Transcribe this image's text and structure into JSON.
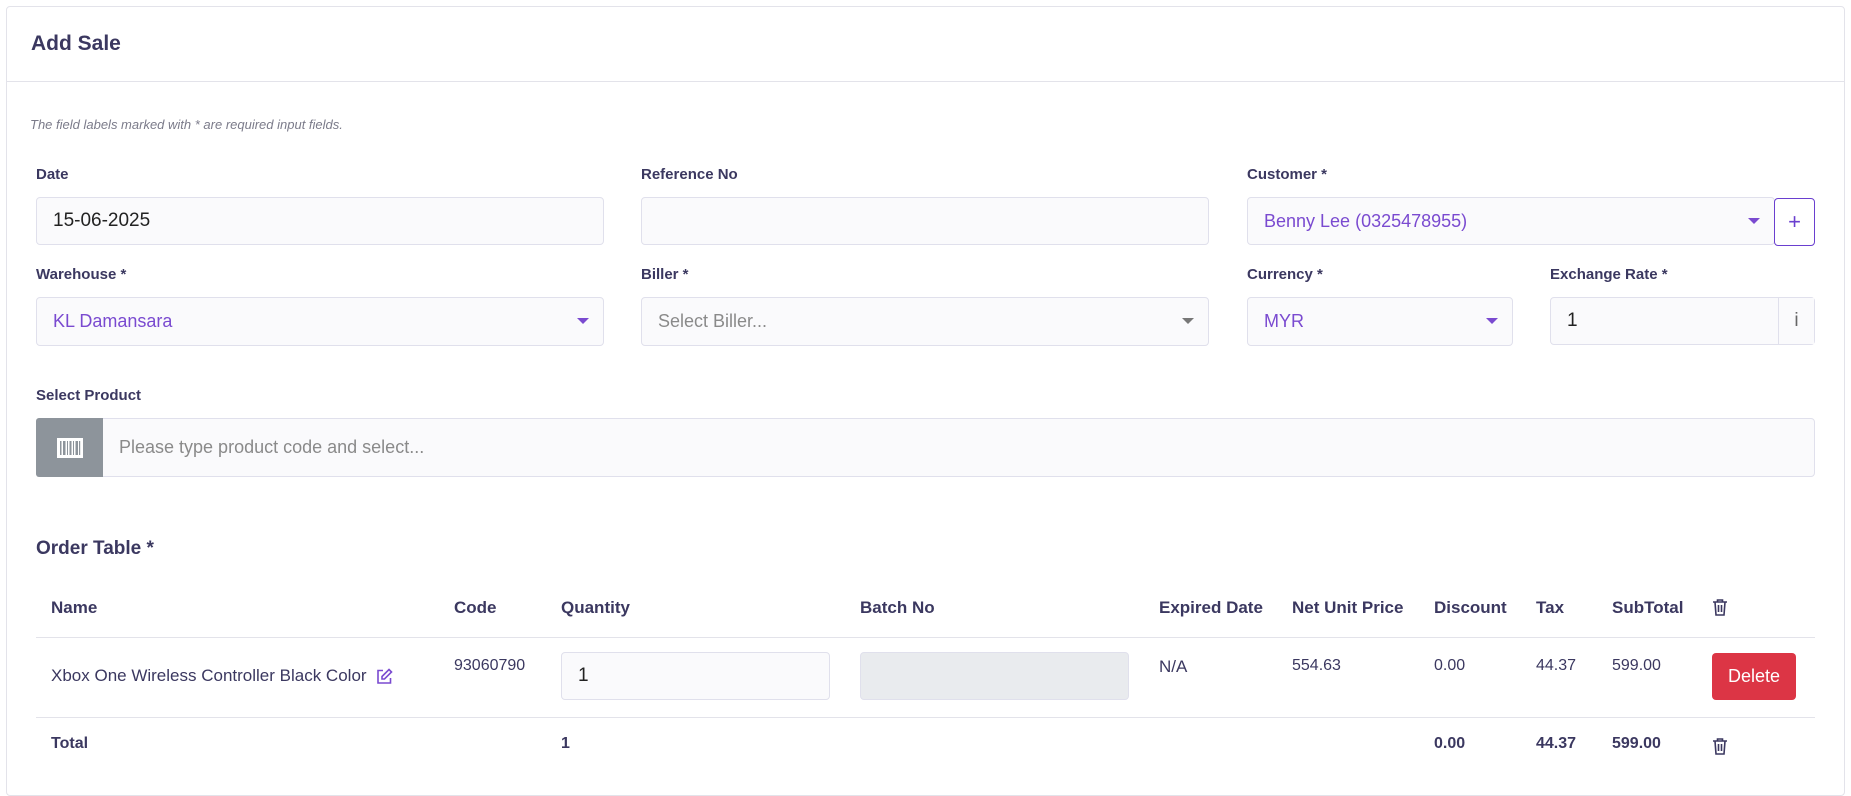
{
  "header": {
    "title": "Add Sale"
  },
  "form": {
    "note": "The field labels marked with * are required input fields.",
    "date": {
      "label": "Date",
      "value": "15-06-2025"
    },
    "reference": {
      "label": "Reference No",
      "value": ""
    },
    "customer": {
      "label": "Customer *",
      "value": "Benny Lee (0325478955)",
      "add_label": "+"
    },
    "warehouse": {
      "label": "Warehouse *",
      "value": "KL Damansara"
    },
    "biller": {
      "label": "Biller *",
      "placeholder": "Select Biller..."
    },
    "currency": {
      "label": "Currency *",
      "value": "MYR"
    },
    "exchange_rate": {
      "label": "Exchange Rate *",
      "value": "1",
      "info": "i"
    },
    "product": {
      "label": "Select Product",
      "placeholder": "Please type product code and select..."
    }
  },
  "order_table": {
    "title": "Order Table *",
    "columns": [
      "Name",
      "Code",
      "Quantity",
      "Batch No",
      "Expired Date",
      "Net Unit Price",
      "Discount",
      "Tax",
      "SubTotal"
    ],
    "rows": [
      {
        "name": "Xbox One Wireless Controller Black Color",
        "code": "93060790",
        "quantity": "1",
        "batch_no": "",
        "expired_date": "N/A",
        "net_unit_price": "554.63",
        "discount": "0.00",
        "tax": "44.37",
        "subtotal": "599.00",
        "delete_label": "Delete"
      }
    ],
    "total": {
      "label": "Total",
      "quantity": "1",
      "discount": "0.00",
      "tax": "44.37",
      "subtotal": "599.00"
    }
  },
  "colors": {
    "accent": "#6a3fcf",
    "danger": "#dc3545",
    "scan_button": "#8d949b"
  },
  "icons": {
    "edit": "edit-icon",
    "trash": "trash-icon",
    "barcode": "barcode-icon",
    "dropdown": "chevron-down-icon"
  }
}
